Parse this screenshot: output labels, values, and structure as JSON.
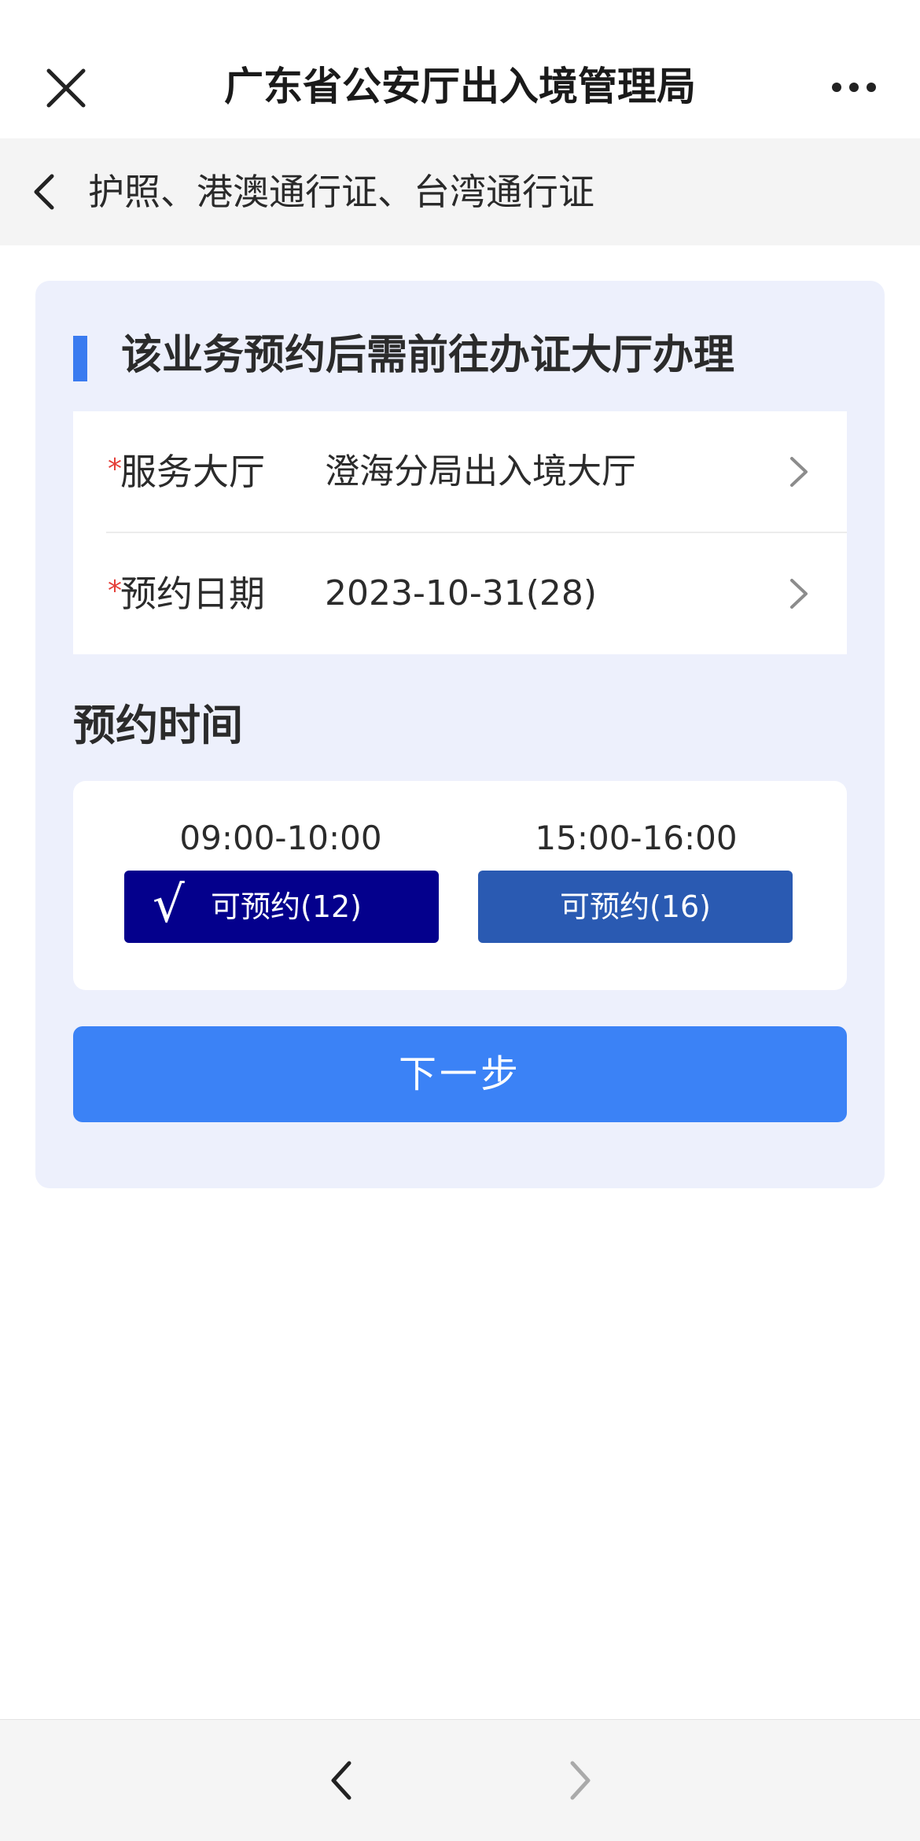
{
  "header": {
    "title": "广东省公安厅出入境管理局",
    "close_icon": "close-icon",
    "more_icon": "more-icon"
  },
  "subheader": {
    "title": "护照、港澳通行证、台湾通行证",
    "back_icon": "chevron-left-icon"
  },
  "panel": {
    "notice": "该业务预约后需前往办证大厅办理",
    "accent_color": "#3a7bf0",
    "form": {
      "required_mark": "*",
      "hall_label": "服务大厅",
      "hall_value": "澄海分局出入境大厅",
      "date_label": "预约日期",
      "date_value": "2023-10-31(28)"
    },
    "time_section_title": "预约时间",
    "slots": [
      {
        "time": "09:00-10:00",
        "status": "可预约(12)",
        "selected": true,
        "check": "√"
      },
      {
        "time": "15:00-16:00",
        "status": "可预约(16)",
        "selected": false
      }
    ],
    "next_button": "下一步",
    "next_button_color": "#3b82f6"
  },
  "bottombar": {
    "back_icon": "chevron-left-icon",
    "forward_icon": "chevron-right-icon"
  }
}
